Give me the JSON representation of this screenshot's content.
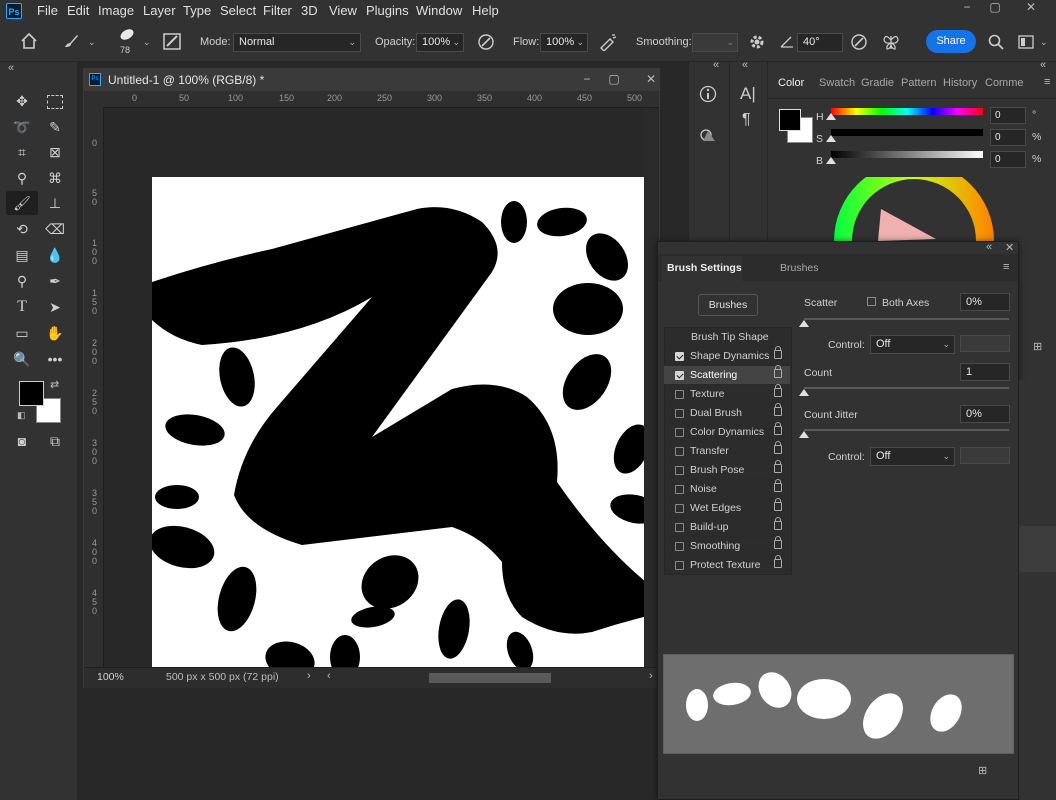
{
  "app": {
    "logo": "Ps"
  },
  "menu": [
    "File",
    "Edit",
    "Image",
    "Layer",
    "Type",
    "Select",
    "Filter",
    "3D",
    "View",
    "Plugins",
    "Window",
    "Help"
  ],
  "window_controls": {
    "minimize": "−",
    "maximize": "▢",
    "close": "✕"
  },
  "options_bar": {
    "brush_size": "78",
    "mode_label": "Mode:",
    "mode_value": "Normal",
    "opacity_label": "Opacity:",
    "opacity_value": "100%",
    "flow_label": "Flow:",
    "flow_value": "100%",
    "smoothing_label": "Smoothing:",
    "angle_value": "40°",
    "share_label": "Share"
  },
  "document": {
    "title": "Untitled-1 @ 100% (RGB/8) *",
    "zoom": "100%",
    "info": "500 px x 500 px (72 ppi)",
    "ruler_top": [
      "0",
      "50",
      "100",
      "150",
      "200",
      "250",
      "300",
      "350",
      "400",
      "450",
      "500"
    ],
    "ruler_left": [
      "0",
      "5 0",
      "1 0 0",
      "1 5 0",
      "2 0 0",
      "2 5 0",
      "3 0 0",
      "3 5 0",
      "4 0 0",
      "4 5 0"
    ]
  },
  "color_panel": {
    "tabs": [
      "Color",
      "Swatch",
      "Gradie",
      "Pattern",
      "History",
      "Comme"
    ],
    "channels": [
      {
        "label": "H",
        "value": "0",
        "unit": "°"
      },
      {
        "label": "S",
        "value": "0",
        "unit": "%"
      },
      {
        "label": "B",
        "value": "0",
        "unit": "%"
      }
    ]
  },
  "brush_panel": {
    "tabs": [
      "Brush Settings",
      "Brushes"
    ],
    "brushes_button": "Brushes",
    "tip_shape": "Brush Tip Shape",
    "options": [
      {
        "label": "Shape Dynamics",
        "checked": true
      },
      {
        "label": "Scattering",
        "checked": true
      },
      {
        "label": "Texture",
        "checked": false
      },
      {
        "label": "Dual Brush",
        "checked": false
      },
      {
        "label": "Color Dynamics",
        "checked": false
      },
      {
        "label": "Transfer",
        "checked": false
      },
      {
        "label": "Brush Pose",
        "checked": false
      },
      {
        "label": "Noise",
        "checked": false
      },
      {
        "label": "Wet Edges",
        "checked": false
      },
      {
        "label": "Build-up",
        "checked": false
      },
      {
        "label": "Smoothing",
        "checked": false
      },
      {
        "label": "Protect Texture",
        "checked": false
      }
    ],
    "scatter_label": "Scatter",
    "both_axes_label": "Both Axes",
    "scatter_value": "0%",
    "control_label": "Control:",
    "control_value": "Off",
    "count_label": "Count",
    "count_value": "1",
    "count_jitter_label": "Count Jitter",
    "count_jitter_value": "0%",
    "control2_value": "Off"
  },
  "colors": {
    "accent": "#1473e6",
    "panel": "#323232",
    "canvas": "#ffffff",
    "ink": "#000000"
  }
}
